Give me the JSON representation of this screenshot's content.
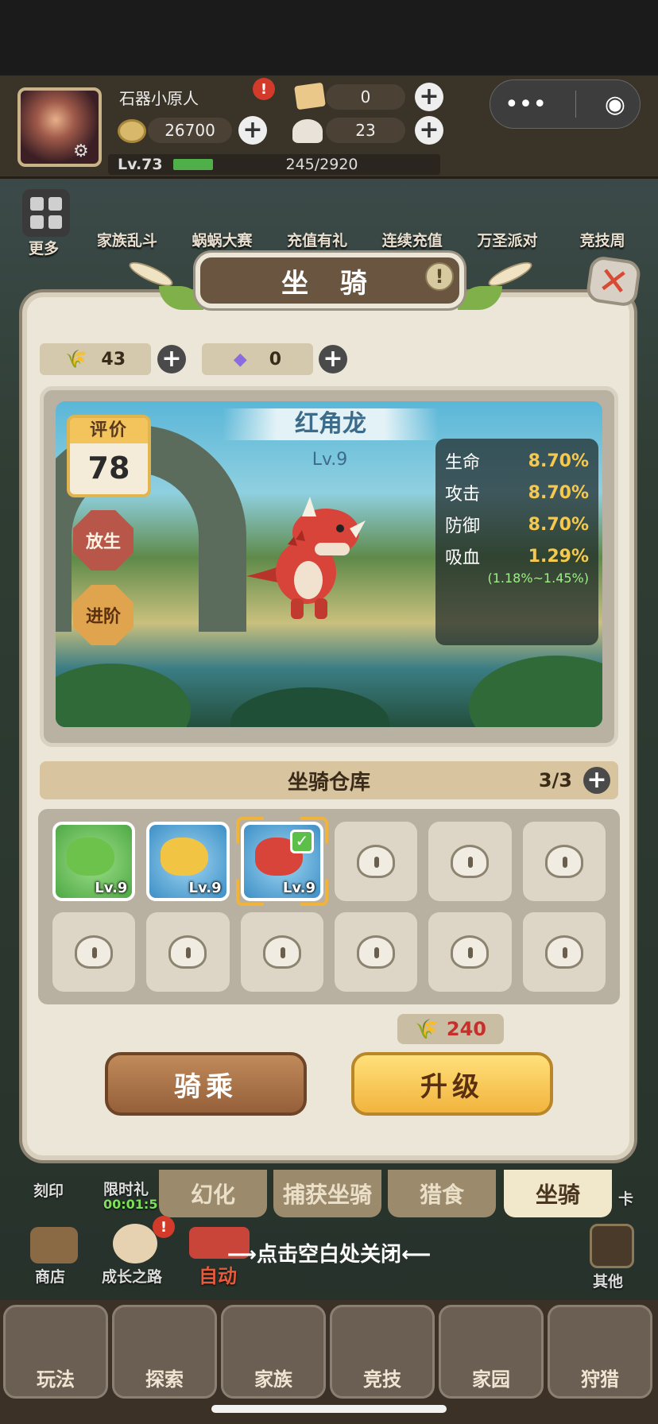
{
  "topbar": {
    "player_name": "石器小原人",
    "ticket_count": "0",
    "coins": "26700",
    "shells": "23",
    "level": "Lv.73",
    "exp": "245/2920",
    "exp_fraction": 0.084
  },
  "events": [
    "更多",
    "家族乱斗",
    "蜗蜗大赛",
    "充值有礼",
    "连续充值",
    "万圣派对",
    "竞技周"
  ],
  "panel": {
    "title": "坐 骑",
    "resources": {
      "wheat": "43",
      "crystal": "0"
    },
    "mount": {
      "score_label": "评价",
      "score": "78",
      "release_label": "放生",
      "advance_label": "进阶",
      "name": "红角龙",
      "level": "Lv.9",
      "stats": [
        {
          "name": "生命",
          "value": "8.70%"
        },
        {
          "name": "攻击",
          "value": "8.70%"
        },
        {
          "name": "防御",
          "value": "8.70%"
        },
        {
          "name": "吸血",
          "value": "1.29%"
        }
      ],
      "lifesteal_range": "(1.18%~1.45%)"
    },
    "warehouse": {
      "title": "坐骑仓库",
      "count": "3/3",
      "pets": [
        {
          "level": "Lv.9",
          "color": "green",
          "selected": false
        },
        {
          "level": "Lv.9",
          "color": "yellow",
          "selected": false
        },
        {
          "level": "Lv.9",
          "color": "red",
          "selected": true
        }
      ],
      "locked_slots": 9
    },
    "upgrade_cost": "240",
    "ride_label": "骑乘",
    "upgrade_label": "升级"
  },
  "tabs": [
    "幻化",
    "捕获坐骑",
    "猎食",
    "坐骑"
  ],
  "active_tab": "坐骑",
  "close_hint": "⟶点击空白处关闭⟵",
  "side": {
    "left_top": "刻印",
    "limited": "限时礼",
    "timer": "00:01:5",
    "shop": "商店",
    "growth": "成长之路",
    "auto": "自动",
    "right_top": "卡",
    "other": "其他"
  },
  "bottom_nav": [
    "玩法",
    "探索",
    "家族",
    "竞技",
    "家园",
    "狩猎"
  ],
  "colors": {
    "accent_gold": "#f2b43e",
    "stat_value": "#f6c94e",
    "range_green": "#9ef08a",
    "cost_red": "#c5302a"
  }
}
